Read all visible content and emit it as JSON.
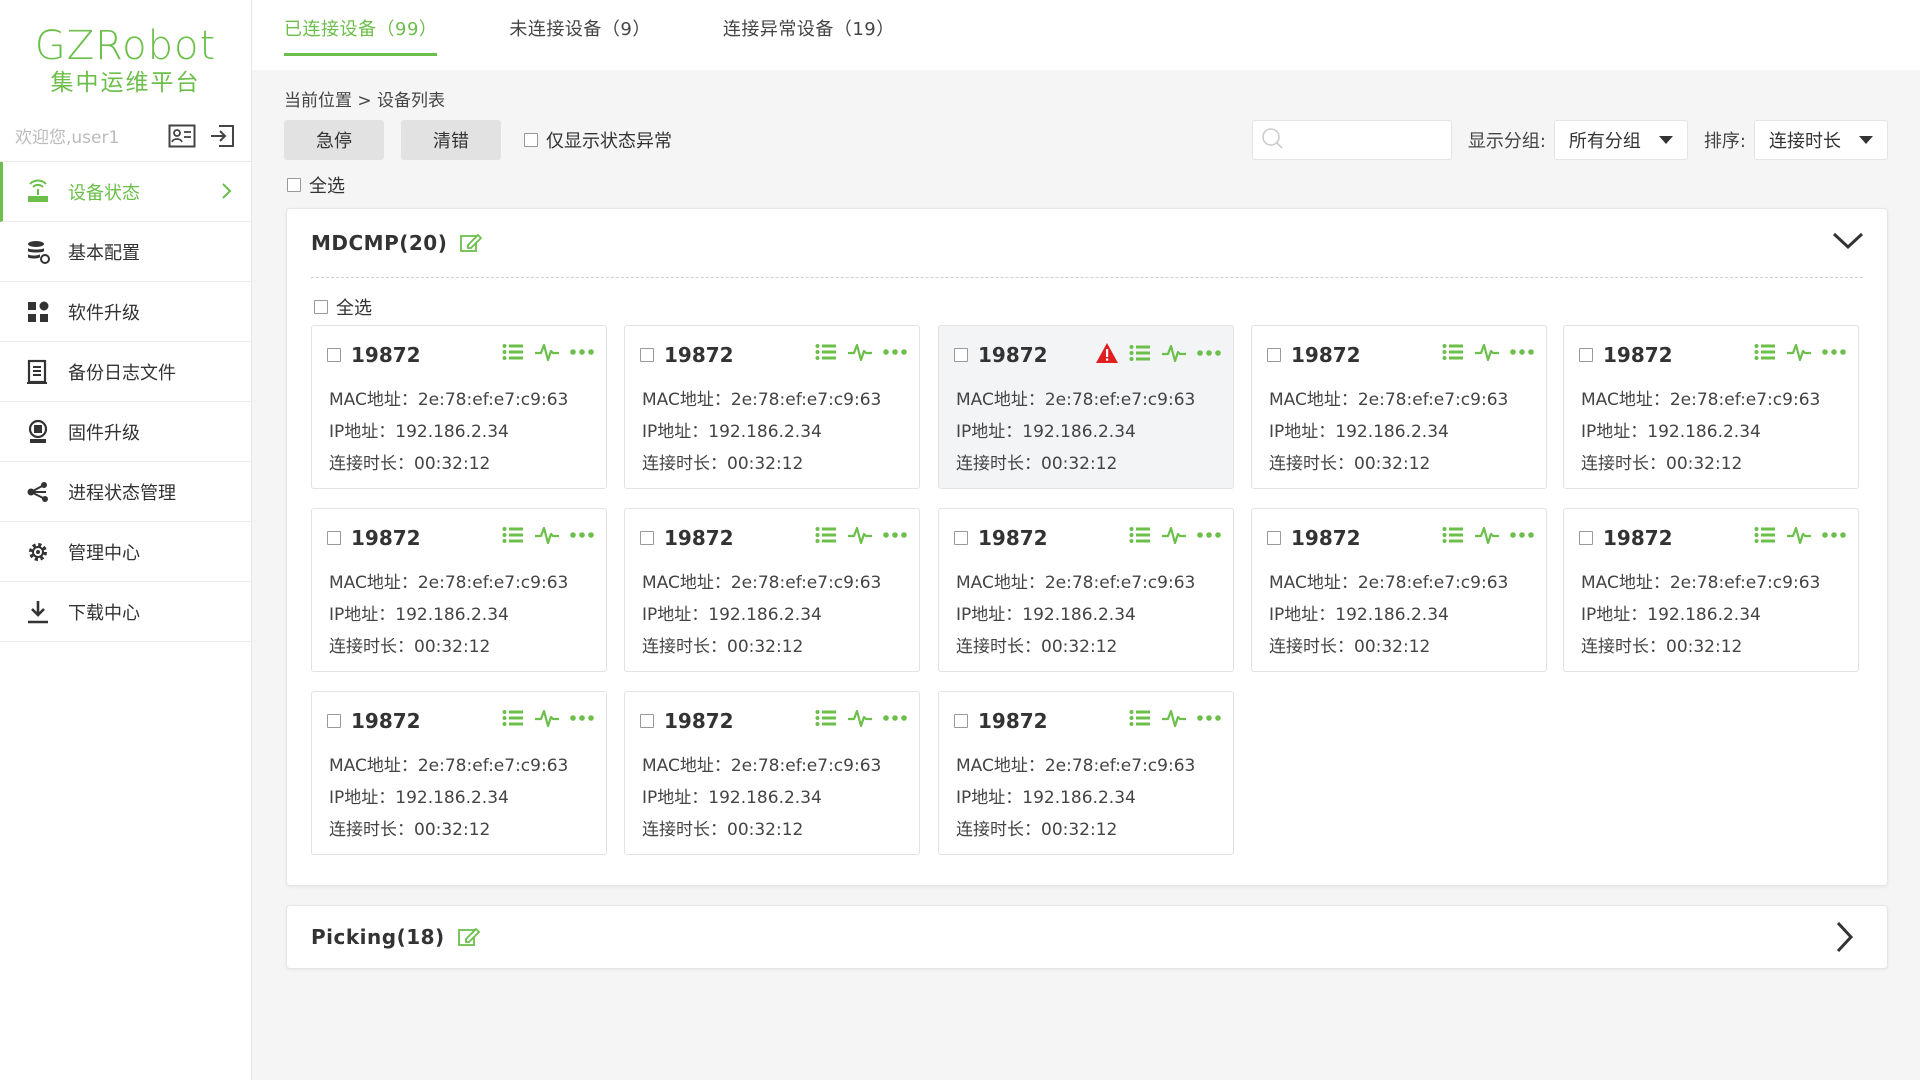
{
  "app": {
    "logo_title": "GZRobot",
    "logo_subtitle": "集中运维平台",
    "welcome": "欢迎您,user1",
    "accent": "#6cbf4a",
    "warn_color": "#e02020"
  },
  "sidebar": {
    "items": [
      {
        "label": "设备状态",
        "icon": "router-icon"
      },
      {
        "label": "基本配置",
        "icon": "database-gear-icon"
      },
      {
        "label": "软件升级",
        "icon": "apps-grid-icon"
      },
      {
        "label": "备份日志文件",
        "icon": "document-icon"
      },
      {
        "label": "固件升级",
        "icon": "chip-upgrade-icon"
      },
      {
        "label": "进程状态管理",
        "icon": "share-nodes-icon"
      },
      {
        "label": "管理中心",
        "icon": "gear-icon"
      },
      {
        "label": "下载中心",
        "icon": "download-icon"
      }
    ]
  },
  "tabs": [
    {
      "label": "已连接设备（99）"
    },
    {
      "label": "未连接设备（9）"
    },
    {
      "label": "连接异常设备（19）"
    }
  ],
  "breadcrumb": "当前位置 > 设备列表",
  "toolbar": {
    "estop_label": "急停",
    "clear_label": "清错",
    "abnormal_only_label": "仅显示状态异常",
    "search_placeholder": "",
    "group_label": "显示分组:",
    "group_value": "所有分组",
    "sort_label": "排序:",
    "sort_value": "连接时长"
  },
  "select_all_label": "全选",
  "groups": [
    {
      "title": "MDCMP(20)",
      "select_all_label": "全选",
      "devices": [
        {
          "name": "19872",
          "mac": "MAC地址：2e:78:ef:e7:c9:63",
          "ip": "IP地址：192.186.2.34",
          "duration": "连接时长：00:32:12",
          "warning": false
        },
        {
          "name": "19872",
          "mac": "MAC地址：2e:78:ef:e7:c9:63",
          "ip": "IP地址：192.186.2.34",
          "duration": "连接时长：00:32:12",
          "warning": false
        },
        {
          "name": "19872",
          "mac": "MAC地址：2e:78:ef:e7:c9:63",
          "ip": "IP地址：192.186.2.34",
          "duration": "连接时长：00:32:12",
          "warning": true
        },
        {
          "name": "19872",
          "mac": "MAC地址：2e:78:ef:e7:c9:63",
          "ip": "IP地址：192.186.2.34",
          "duration": "连接时长：00:32:12",
          "warning": false
        },
        {
          "name": "19872",
          "mac": "MAC地址：2e:78:ef:e7:c9:63",
          "ip": "IP地址：192.186.2.34",
          "duration": "连接时长：00:32:12",
          "warning": false
        },
        {
          "name": "19872",
          "mac": "MAC地址：2e:78:ef:e7:c9:63",
          "ip": "IP地址：192.186.2.34",
          "duration": "连接时长：00:32:12",
          "warning": false
        },
        {
          "name": "19872",
          "mac": "MAC地址：2e:78:ef:e7:c9:63",
          "ip": "IP地址：192.186.2.34",
          "duration": "连接时长：00:32:12",
          "warning": false
        },
        {
          "name": "19872",
          "mac": "MAC地址：2e:78:ef:e7:c9:63",
          "ip": "IP地址：192.186.2.34",
          "duration": "连接时长：00:32:12",
          "warning": false
        },
        {
          "name": "19872",
          "mac": "MAC地址：2e:78:ef:e7:c9:63",
          "ip": "IP地址：192.186.2.34",
          "duration": "连接时长：00:32:12",
          "warning": false
        },
        {
          "name": "19872",
          "mac": "MAC地址：2e:78:ef:e7:c9:63",
          "ip": "IP地址：192.186.2.34",
          "duration": "连接时长：00:32:12",
          "warning": false
        },
        {
          "name": "19872",
          "mac": "MAC地址：2e:78:ef:e7:c9:63",
          "ip": "IP地址：192.186.2.34",
          "duration": "连接时长：00:32:12",
          "warning": false
        },
        {
          "name": "19872",
          "mac": "MAC地址：2e:78:ef:e7:c9:63",
          "ip": "IP地址：192.186.2.34",
          "duration": "连接时长：00:32:12",
          "warning": false
        },
        {
          "name": "19872",
          "mac": "MAC地址：2e:78:ef:e7:c9:63",
          "ip": "IP地址：192.186.2.34",
          "duration": "连接时长：00:32:12",
          "warning": false
        }
      ]
    },
    {
      "title": "Picking(18)"
    }
  ]
}
